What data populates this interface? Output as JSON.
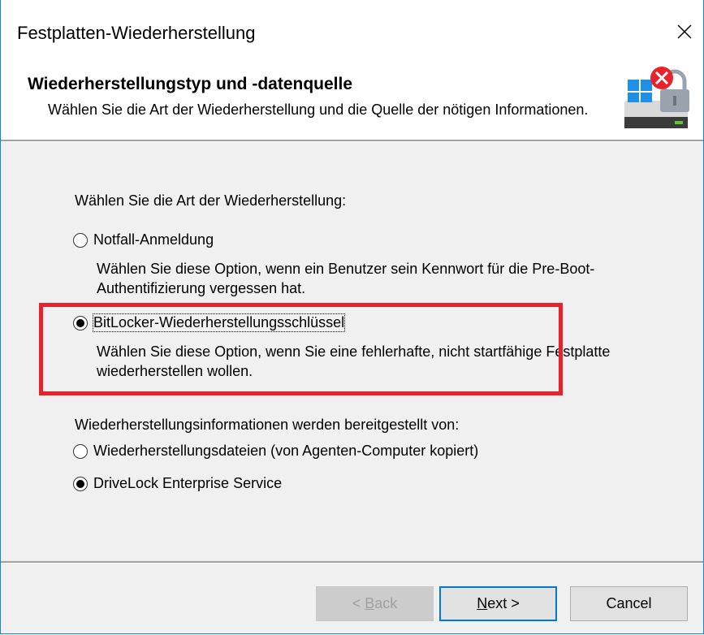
{
  "window": {
    "title": "Festplatten-Wiederherstellung",
    "close_glyph": "✕"
  },
  "header": {
    "title": "Wiederherstellungstyp und -datenquelle",
    "subtitle": "Wählen Sie die Art der Wiederherstellung und die Quelle der nötigen Informationen.",
    "icon": "drive-lock-error-icon"
  },
  "recovery_type": {
    "label": "Wählen Sie die Art der Wiederherstellung:",
    "options": [
      {
        "label": "Notfall-Anmeldung",
        "description": "Wählen Sie diese Option, wenn ein Benutzer sein Kennwort für die Pre-Boot-Authentifizierung vergessen hat.",
        "selected": false
      },
      {
        "label": "BitLocker-Wiederherstellungsschlüssel",
        "description": "Wählen Sie diese Option, wenn Sie eine fehlerhafte, nicht startfähige Festplatte wiederherstellen wollen.",
        "selected": true
      }
    ]
  },
  "source": {
    "label": "Wiederherstellungsinformationen werden bereitgestellt von:",
    "options": [
      {
        "label": "Wiederherstellungsdateien (von Agenten-Computer kopiert)",
        "selected": false
      },
      {
        "label": "DriveLock Enterprise Service",
        "selected": true
      }
    ]
  },
  "buttons": {
    "back": {
      "prefix": "< ",
      "mnemonic": "B",
      "rest": "ack",
      "enabled": false
    },
    "next": {
      "mnemonic": "N",
      "rest": "ext >",
      "enabled": true
    },
    "cancel": {
      "label": "Cancel",
      "enabled": true
    }
  },
  "colors": {
    "highlight": "#e8222b",
    "window_border": "#1883d7",
    "default_button_border": "#0078d7"
  }
}
